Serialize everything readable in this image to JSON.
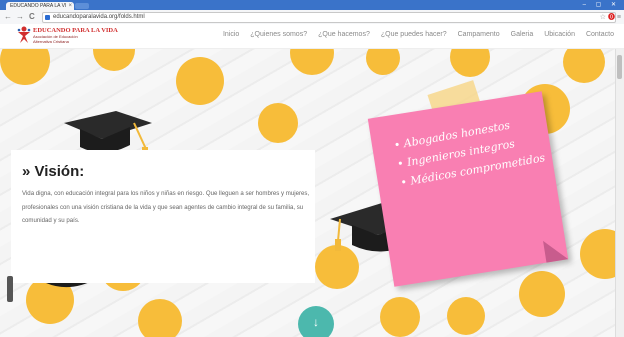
{
  "browser": {
    "tab_title": "EDUCANDO PARA LA VI",
    "tab_close": "×",
    "url": "educandoparalavida.org/folds.html",
    "back": "←",
    "forward": "→",
    "reload": "C",
    "star": "☆",
    "adblock": "⓿",
    "menu": "≡",
    "window_controls": "– ▢ ✕"
  },
  "site": {
    "logo_title": "EDUCANDO PARA LA VIDA",
    "logo_sub1": "Asociación de Educación",
    "logo_sub2": "Alternativa Cristiana",
    "nav": [
      "Inicio",
      "¿Quienes somos?",
      "¿Que hacemos?",
      "¿Que puedes hacer?",
      "Campamento",
      "Galeria",
      "Ubicación",
      "Contacto"
    ]
  },
  "vision": {
    "title": "» Visión:",
    "text": "Vida digna, con educación integral para los niños y niñas en riesgo. Que lleguen a ser hombres y mujeres, profesionales con una visión cristiana de la vida y que sean agentes de cambio integral de su familia, su comunidad y su país."
  },
  "note": {
    "items": [
      "• Abogados honestos",
      "• Ingenieros integros",
      "• Médicos comprometidos"
    ]
  },
  "scroll_down": "↓",
  "colors": {
    "dot": "#f7bd3a",
    "note": "#f97fb2",
    "accent": "#4cb8ad",
    "logo_red": "#d12f2f",
    "tabbar": "#3a73c9"
  },
  "icons": [
    "close-icon",
    "back-icon",
    "forward-icon",
    "reload-icon",
    "star-icon",
    "adblock-icon",
    "menu-icon",
    "graduation-cap-icon",
    "arrow-down-icon"
  ]
}
